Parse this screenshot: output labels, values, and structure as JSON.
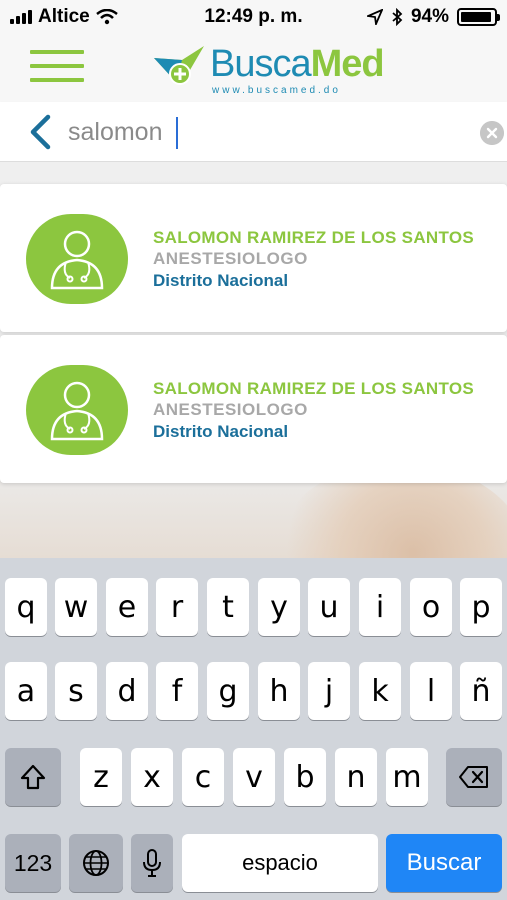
{
  "status_bar": {
    "carrier": "Altice",
    "time": "12:49 p. m.",
    "battery": "94%",
    "battery_level": 0.94
  },
  "header": {
    "logo_busca": "Busca",
    "logo_med": "Med",
    "logo_url": "www.buscamed.do"
  },
  "search": {
    "value": "salomon",
    "placeholder": ""
  },
  "results": [
    {
      "name": "SALOMON RAMIREZ DE LOS SANTOS",
      "specialty": "ANESTESIOLOGO",
      "location": "Distrito Nacional"
    },
    {
      "name": "SALOMON RAMIREZ DE LOS SANTOS",
      "specialty": "ANESTESIOLOGO",
      "location": "Distrito Nacional"
    }
  ],
  "keyboard": {
    "row1": [
      "q",
      "w",
      "e",
      "r",
      "t",
      "y",
      "u",
      "i",
      "o",
      "p"
    ],
    "row2": [
      "a",
      "s",
      "d",
      "f",
      "g",
      "h",
      "j",
      "k",
      "l",
      "ñ"
    ],
    "row3": [
      "z",
      "x",
      "c",
      "v",
      "b",
      "n",
      "m"
    ],
    "numbers_label": "123",
    "space_label": "espacio",
    "action_label": "Buscar"
  },
  "colors": {
    "brand_green": "#8cc63f",
    "brand_blue": "#1e8bb3",
    "location_blue": "#1b6f9a",
    "keyboard_action": "#1f86f6"
  },
  "icons": [
    "signal-icon",
    "wifi-icon",
    "location-arrow-icon",
    "bluetooth-icon",
    "battery-icon",
    "hamburger-menu-icon",
    "back-chevron-icon",
    "clear-icon",
    "doctor-avatar-icon",
    "shift-icon",
    "globe-icon",
    "microphone-icon",
    "backspace-icon"
  ]
}
